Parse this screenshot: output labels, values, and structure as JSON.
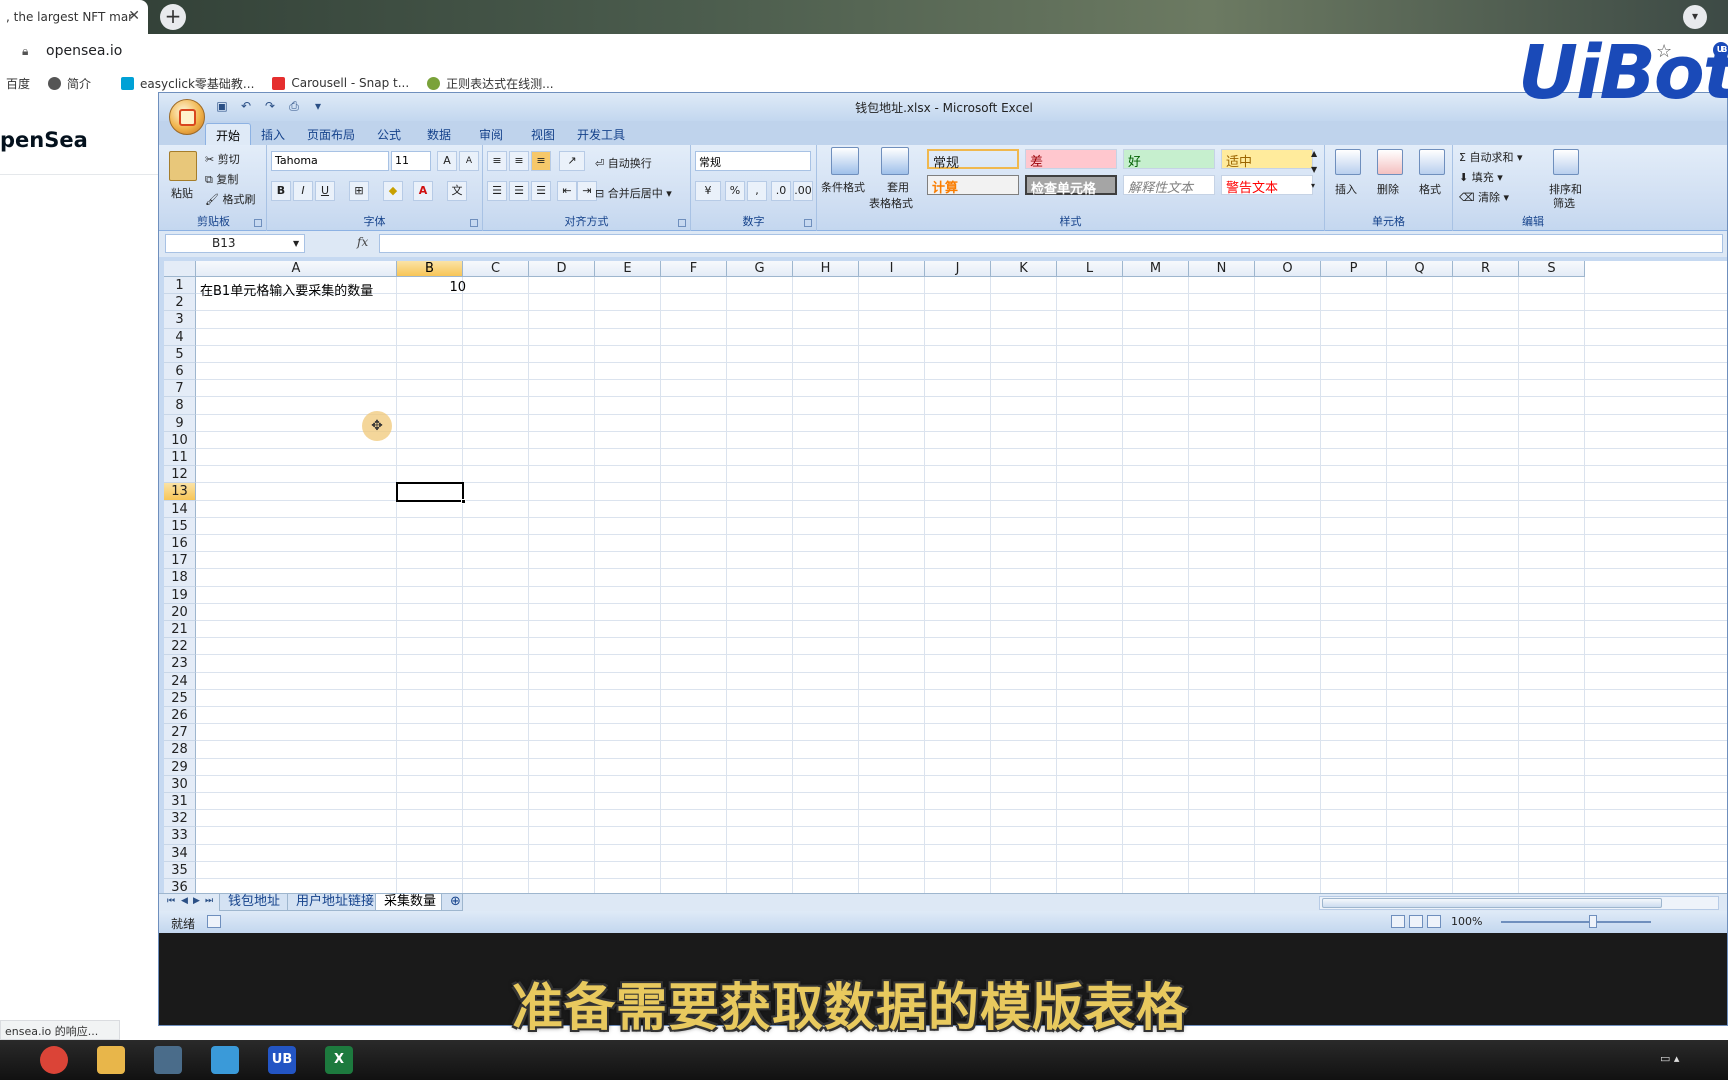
{
  "browser": {
    "tab_title": ", the largest NFT mar",
    "url": "opensea.io",
    "bookmarks": [
      {
        "label": "百度",
        "color": "#ffffff"
      },
      {
        "label": "简介",
        "color": "#555555"
      },
      {
        "label": "easyclick零基础教...",
        "color": "#00a1d6"
      },
      {
        "label": "Carousell - Snap t...",
        "color": "#e52e2e"
      },
      {
        "label": "正则表达式在线测...",
        "color": "#7aa23a"
      }
    ],
    "page_brand": "penSea",
    "status_tooltip": "ensea.io 的响应...",
    "overlay_logo": "UiBot"
  },
  "excel": {
    "title": "钱包地址.xlsx - Microsoft Excel",
    "ribbon_tabs": [
      "开始",
      "插入",
      "页面布局",
      "公式",
      "数据",
      "审阅",
      "视图",
      "开发工具"
    ],
    "active_tab": "开始",
    "clipboard": {
      "label": "剪贴板",
      "paste": "粘贴",
      "cut": "剪切",
      "copy": "复制",
      "format_painter": "格式刷"
    },
    "font": {
      "label": "字体",
      "name": "Tahoma",
      "size": "11"
    },
    "alignment": {
      "label": "对齐方式",
      "wrap": "自动换行",
      "merge": "合并后居中"
    },
    "number": {
      "label": "数字",
      "format": "常规"
    },
    "styles": {
      "label": "样式",
      "conditional": "条件格式",
      "table_format_1": "套用",
      "table_format_2": "表格格式",
      "cells": [
        {
          "text": "常规",
          "color": "#000000",
          "bg": "#ffffff"
        },
        {
          "text": "差",
          "color": "#9c0006",
          "bg": "#ffc7ce"
        },
        {
          "text": "好",
          "color": "#006100",
          "bg": "#c6efce"
        },
        {
          "text": "适中",
          "color": "#9c6500",
          "bg": "#ffeb9c"
        },
        {
          "text": "计算",
          "color": "#fa7d00",
          "bg": "#f2f2f2"
        },
        {
          "text": "检查单元格",
          "color": "#ffffff",
          "bg": "#a5a5a5"
        },
        {
          "text": "解释性文本",
          "color": "#7f7f7f",
          "bg": "#ffffff"
        },
        {
          "text": "警告文本",
          "color": "#ff0000",
          "bg": "#ffffff"
        }
      ]
    },
    "cells_group": {
      "label": "单元格",
      "insert": "插入",
      "delete": "删除",
      "format": "格式"
    },
    "editing": {
      "label": "编辑",
      "autosum": "自动求和",
      "fill": "填充",
      "clear": "清除",
      "sort_1": "排序和",
      "sort_2": "筛选"
    },
    "name_box": "B13",
    "fx": "fx",
    "columns": [
      "A",
      "B",
      "C",
      "D",
      "E",
      "F",
      "G",
      "H",
      "I",
      "J",
      "K",
      "L",
      "M",
      "N",
      "O",
      "P",
      "Q",
      "R",
      "S"
    ],
    "selected_column": "B",
    "selected_row": 13,
    "rows": [
      "1",
      "2",
      "3",
      "4",
      "5",
      "6",
      "7",
      "8",
      "9",
      "10",
      "11",
      "12",
      "13",
      "14",
      "15",
      "16",
      "17",
      "18",
      "19",
      "20",
      "21",
      "22",
      "23",
      "24",
      "25",
      "26",
      "27",
      "28",
      "29",
      "30",
      "31",
      "32",
      "33",
      "34",
      "35",
      "36"
    ],
    "cell_A1": "在B1单元格输入要采集的数量",
    "cell_B1": "10",
    "sheets": [
      "钱包地址",
      "用户地址链接",
      "采集数量"
    ],
    "active_sheet": "采集数量",
    "status": "就绪",
    "zoom": "100%"
  },
  "caption": "准备需要获取数据的模版表格",
  "taskbar": {
    "apps": [
      {
        "name": "chrome",
        "label": "",
        "color": "#db4437"
      },
      {
        "name": "explorer",
        "label": "",
        "color": "#e8b64a"
      },
      {
        "name": "terminal",
        "label": "",
        "color": "#4a6c8a"
      },
      {
        "name": "remote",
        "label": "",
        "color": "#3a9ad9"
      },
      {
        "name": "uibot",
        "label": "UB",
        "color": "#2355c4"
      },
      {
        "name": "excel",
        "label": "X",
        "color": "#1d7a3e"
      }
    ]
  }
}
